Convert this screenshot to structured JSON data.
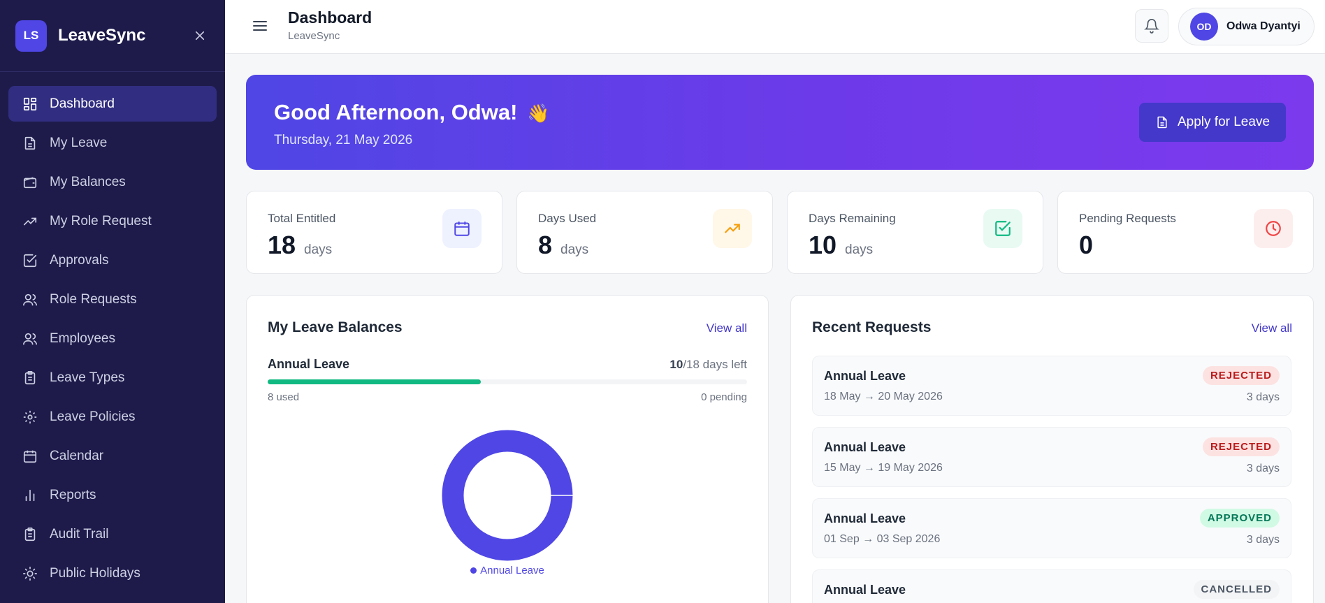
{
  "app": {
    "logo_initials": "LS",
    "name": "LeaveSync"
  },
  "sidebar": {
    "items": [
      {
        "label": "Dashboard",
        "icon": "dashboard-icon",
        "active": true
      },
      {
        "label": "My Leave",
        "icon": "document-icon"
      },
      {
        "label": "My Balances",
        "icon": "wallet-icon"
      },
      {
        "label": "My Role Request",
        "icon": "trending-up-icon"
      },
      {
        "label": "Approvals",
        "icon": "check-square-icon"
      },
      {
        "label": "Role Requests",
        "icon": "users-icon"
      },
      {
        "label": "Employees",
        "icon": "users-icon"
      },
      {
        "label": "Leave Types",
        "icon": "clipboard-icon"
      },
      {
        "label": "Leave Policies",
        "icon": "gear-icon"
      },
      {
        "label": "Calendar",
        "icon": "calendar-icon"
      },
      {
        "label": "Reports",
        "icon": "bar-chart-icon"
      },
      {
        "label": "Audit Trail",
        "icon": "clipboard-icon"
      },
      {
        "label": "Public Holidays",
        "icon": "sun-icon"
      }
    ]
  },
  "header": {
    "title": "Dashboard",
    "subtitle": "LeaveSync",
    "user_initials": "OD",
    "user_name": "Odwa Dyantyi"
  },
  "hero": {
    "greeting": "Good Afternoon, Odwa!",
    "emoji": "👋",
    "date": "Thursday, 21 May 2026",
    "apply_label": "Apply for Leave"
  },
  "stats": [
    {
      "label": "Total Entitled",
      "value": "18",
      "unit": "days",
      "icon": "calendar-icon",
      "color": "#4f46e5",
      "bg": "#eef2ff"
    },
    {
      "label": "Days Used",
      "value": "8",
      "unit": "days",
      "icon": "trending-up-icon",
      "color": "#f59e0b",
      "bg": "#fff7e8"
    },
    {
      "label": "Days Remaining",
      "value": "10",
      "unit": "days",
      "icon": "check-square-icon",
      "color": "#10b981",
      "bg": "#e9faf3"
    },
    {
      "label": "Pending Requests",
      "value": "0",
      "unit": "",
      "icon": "clock-icon",
      "color": "#ef4444",
      "bg": "#fdeeee"
    }
  ],
  "balances": {
    "title": "My Leave Balances",
    "view_all": "View all",
    "item": {
      "name": "Annual Leave",
      "remaining": "10",
      "total_text": "/18 days left",
      "used_text": "8 used",
      "pending_text": "0 pending",
      "used_fraction": 0.444,
      "bar_color": "#10b981"
    },
    "donut": {
      "legend": "Annual Leave",
      "color": "#4f46e5",
      "slices": [
        {
          "label": "Annual Leave",
          "value": 10
        }
      ]
    }
  },
  "recent": {
    "title": "Recent Requests",
    "view_all": "View all",
    "items": [
      {
        "type": "Annual Leave",
        "dates": "18 May → 20 May 2026",
        "status": "REJECTED",
        "days": "3 days",
        "badge_bg": "#fde2e2",
        "badge_fg": "#b91c1c"
      },
      {
        "type": "Annual Leave",
        "dates": "15 May → 19 May 2026",
        "status": "REJECTED",
        "days": "3 days",
        "badge_bg": "#fde2e2",
        "badge_fg": "#b91c1c"
      },
      {
        "type": "Annual Leave",
        "dates": "01 Sep → 03 Sep 2026",
        "status": "APPROVED",
        "days": "3 days",
        "badge_bg": "#d1fae5",
        "badge_fg": "#047857"
      },
      {
        "type": "Annual Leave",
        "dates": "",
        "status": "CANCELLED",
        "days": "",
        "badge_bg": "#f3f4f6",
        "badge_fg": "#4b5563"
      }
    ]
  }
}
